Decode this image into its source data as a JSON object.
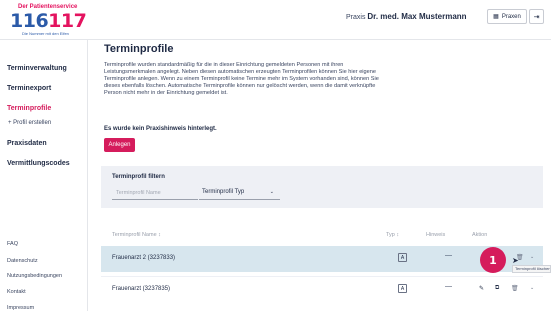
{
  "logo": {
    "top": "Der Patientenservice",
    "num_a": "116",
    "num_b": "117",
    "sub": "Die Nummer mit den Elfen"
  },
  "header": {
    "praxis_prefix": "Praxis",
    "doctor": "Dr. med. Max Mustermann",
    "praxen_label": "Praxen",
    "praxen_icon": "building-icon",
    "logout_icon": "logout-icon"
  },
  "sidebar": {
    "items": [
      {
        "label": "Terminverwaltung",
        "active": false
      },
      {
        "label": "Terminexport",
        "active": false
      },
      {
        "label": "Terminprofile",
        "active": true
      },
      {
        "label": "Praxisdaten",
        "active": false
      },
      {
        "label": "Vermittlungscodes",
        "active": false
      }
    ],
    "sub_item": "+ Profil erstellen",
    "footer": [
      "FAQ",
      "Datenschutz",
      "Nutzungsbedingungen",
      "Kontakt",
      "Impressum"
    ]
  },
  "main": {
    "title": "Terminprofile",
    "description": "Terminprofile wurden standardmäßig für die in dieser Einrichtung gemeldeten Personen mit ihren Leistungsmerkmalen angelegt. Neben diesen automatischen erzeugten Terminprofilen können Sie hier eigene Terminprofile anlegen. Wenn zu einem Terminprofil keine Termine mehr im System vorhanden sind, können Sie dieses ebenfalls löschen. Automatische Terminprofile können nur gelöscht werden, wenn die damit verknüpfte Person nicht mehr in der Einrichtung gemeldet ist.",
    "hint": "Es wurde kein Praxishinweis hinterlegt.",
    "anlegen": "Anlegen"
  },
  "filter": {
    "title": "Terminprofil filtern",
    "name_placeholder": "Terminprofil Name",
    "type_value": "Terminprofil Typ"
  },
  "table": {
    "headers": {
      "name": "Terminprofil Name ↕",
      "typ": "Typ ↕",
      "hinweis": "Hinweis",
      "aktion": "Aktion"
    },
    "rows": [
      {
        "name": "Frauenarzt 2 (3237833)",
        "typ": "A",
        "hinweis": "—"
      },
      {
        "name": "Frauenarzt (3237835)",
        "typ": "A",
        "hinweis": "—"
      }
    ]
  },
  "overlay": {
    "callout": "1",
    "tooltip": "Terminprofil löschen"
  },
  "colors": {
    "accent": "#d51c5c",
    "highlight_row": "#d7e6ee",
    "filter_bg": "#eef0f5"
  }
}
